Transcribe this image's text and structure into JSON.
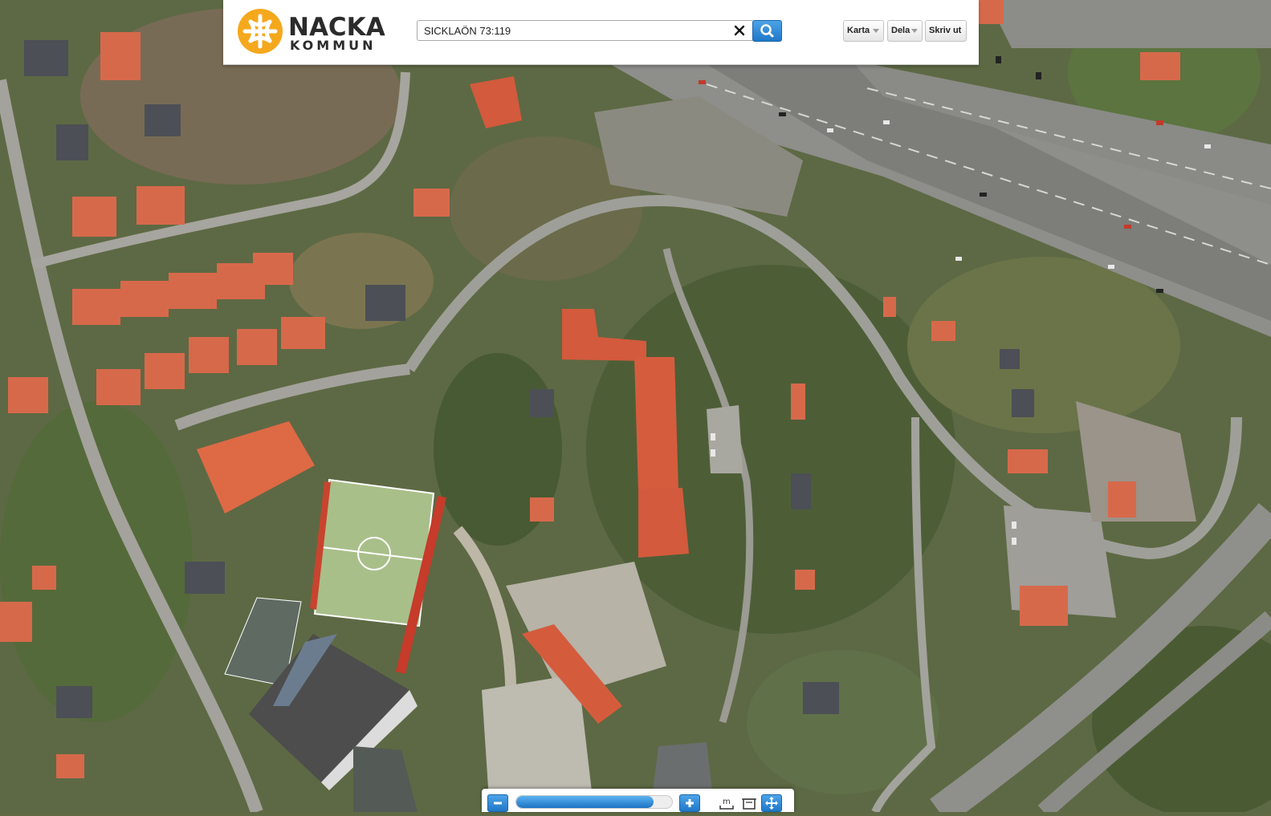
{
  "header": {
    "logo_name": "NACKA",
    "logo_sub": "KOMMUN",
    "brand_color": "#f5a81c"
  },
  "search": {
    "value": "SICKLAÖN 73:119",
    "clear_icon": "close-icon",
    "search_icon": "magnifier-icon"
  },
  "toolbar": {
    "map_label": "Karta",
    "share_label": "Dela",
    "print_label": "Skriv ut"
  },
  "zoom": {
    "level": 0.88,
    "zoom_out_icon": "minus-icon",
    "zoom_in_icon": "plus-icon",
    "tools": [
      "measure-distance-icon",
      "measure-area-icon",
      "pan-icon"
    ],
    "measure_label": "m"
  },
  "colors": {
    "accent_blue": "#2a8ad8",
    "map_foliage": "#5f6a45",
    "map_road": "#9a9a95",
    "roof_red": "#d7583a"
  }
}
